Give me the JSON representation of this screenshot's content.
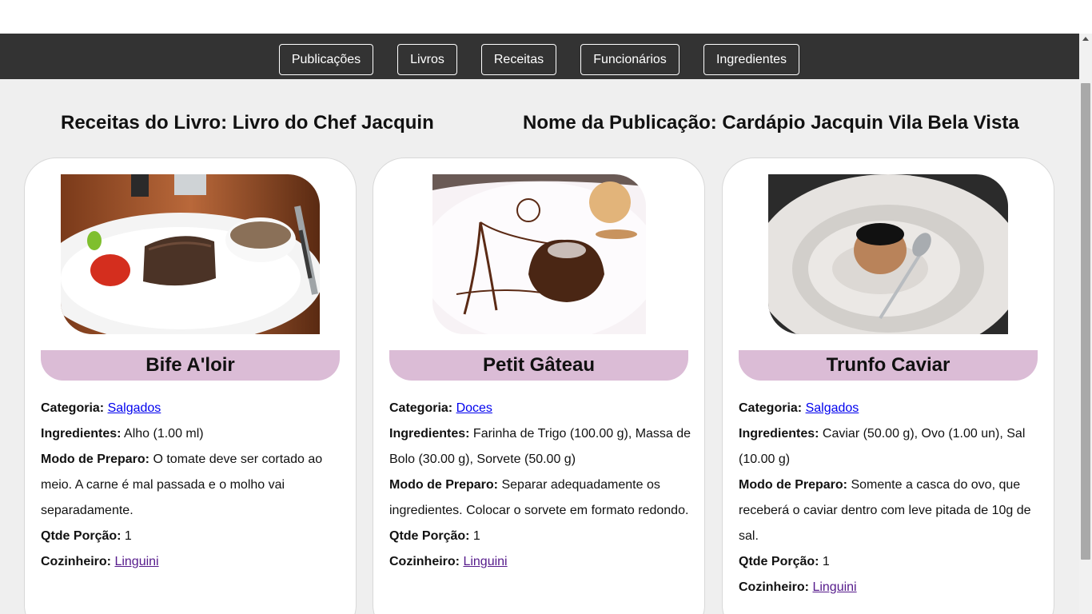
{
  "nav": {
    "items": [
      {
        "label": "Publicações"
      },
      {
        "label": "Livros"
      },
      {
        "label": "Receitas"
      },
      {
        "label": "Funcionários"
      },
      {
        "label": "Ingredientes"
      }
    ]
  },
  "headings": {
    "book": "Receitas do Livro: Livro do Chef Jacquin",
    "publication": "Nome da Publicação: Cardápio Jacquin Vila Bela Vista"
  },
  "labels": {
    "category": "Categoria:",
    "ingredients": "Ingredientes:",
    "preparation": "Modo de Preparo:",
    "portion": "Qtde Porção:",
    "cook": "Cozinheiro:"
  },
  "recipes": [
    {
      "name": "Bife A'loir",
      "category": "Salgados",
      "ingredients": "Alho (1.00 ml)",
      "preparation": "O tomate deve ser cortado ao meio. A carne é mal passada e o molho vai separadamente.",
      "portion": "1",
      "cook": "Linguini"
    },
    {
      "name": "Petit Gâteau",
      "category": "Doces",
      "ingredients": "Farinha de Trigo (100.00 g), Massa de Bolo (30.00 g), Sorvete (50.00 g)",
      "preparation": "Separar adequadamente os ingredientes. Colocar o sorvete em formato redondo.",
      "portion": "1",
      "cook": "Linguini"
    },
    {
      "name": "Trunfo Caviar",
      "category": "Salgados",
      "ingredients": "Caviar (50.00 g), Ovo (1.00 un), Sal (10.00 g)",
      "preparation": "Somente a casca do ovo, que receberá o caviar dentro com leve pitada de 10g de sal.",
      "portion": "1",
      "cook": "Linguini"
    }
  ]
}
